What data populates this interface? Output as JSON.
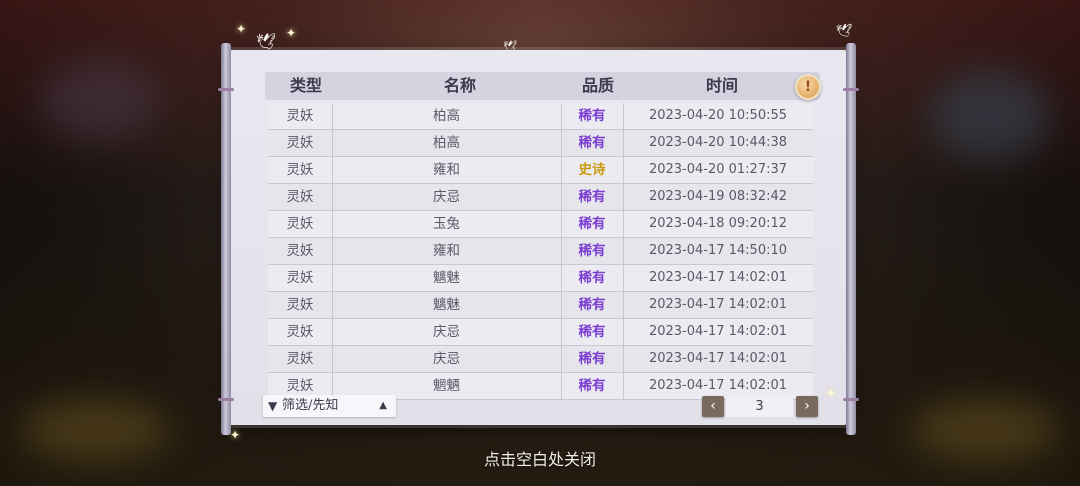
{
  "table": {
    "headers": {
      "type": "类型",
      "name": "名称",
      "quality": "品质",
      "time": "时间"
    },
    "rows": [
      {
        "type": "灵妖",
        "name": "柏高",
        "quality": "稀有",
        "time": "2023-04-20  10:50:55"
      },
      {
        "type": "灵妖",
        "name": "柏高",
        "quality": "稀有",
        "time": "2023-04-20  10:44:38"
      },
      {
        "type": "灵妖",
        "name": "雍和",
        "quality": "史诗",
        "time": "2023-04-20  01:27:37"
      },
      {
        "type": "灵妖",
        "name": "庆忌",
        "quality": "稀有",
        "time": "2023-04-19  08:32:42"
      },
      {
        "type": "灵妖",
        "name": "玉兔",
        "quality": "稀有",
        "time": "2023-04-18  09:20:12"
      },
      {
        "type": "灵妖",
        "name": "雍和",
        "quality": "稀有",
        "time": "2023-04-17  14:50:10"
      },
      {
        "type": "灵妖",
        "name": "魑魅",
        "quality": "稀有",
        "time": "2023-04-17  14:02:01"
      },
      {
        "type": "灵妖",
        "name": "魑魅",
        "quality": "稀有",
        "time": "2023-04-17  14:02:01"
      },
      {
        "type": "灵妖",
        "name": "庆忌",
        "quality": "稀有",
        "time": "2023-04-17  14:02:01"
      },
      {
        "type": "灵妖",
        "name": "庆忌",
        "quality": "稀有",
        "time": "2023-04-17  14:02:01"
      },
      {
        "type": "灵妖",
        "name": "魍魉",
        "quality": "稀有",
        "time": "2023-04-17  14:02:01"
      }
    ]
  },
  "quality_colors": {
    "稀有": "#7a3fd1",
    "史诗": "#c99a10"
  },
  "info_button": {
    "icon": "exclamation-icon",
    "glyph": "!"
  },
  "filter": {
    "label": "筛选/先知",
    "icon": "funnel-icon",
    "arrow_icon": "chevron-up-icon"
  },
  "pager": {
    "prev_icon": "chevron-left-icon",
    "next_icon": "chevron-right-icon",
    "page": "3"
  },
  "close_hint": "点击空白处关闭"
}
